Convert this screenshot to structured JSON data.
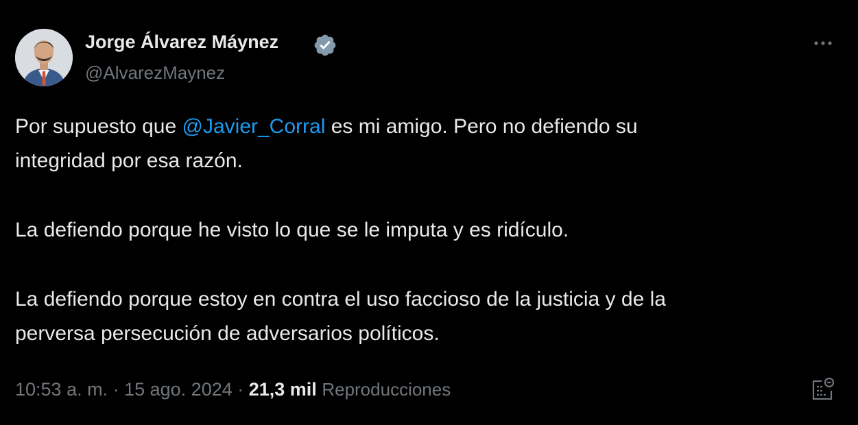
{
  "author": {
    "display_name": "Jorge Álvarez Máynez",
    "handle": "@AlvarezMaynez",
    "verified": true
  },
  "icons": {
    "verified": "verified-badge-icon",
    "more": "more-options-icon",
    "analytics": "post-analytics-icon"
  },
  "tweet": {
    "line1_before": "Por supuesto que ",
    "mention": "@Javier_Corral",
    "line1_after": " es mi amigo. Pero no defiendo su",
    "line2": "integridad por esa razón.",
    "para2": "La defiendo porque he visto lo que se le imputa y es ridículo.",
    "para3_line1": "La defiendo porque estoy en contra el uso faccioso de la justicia y de la",
    "para3_line2": "perversa persecución de adversarios políticos."
  },
  "meta": {
    "time": "10:53 a. m.",
    "separator": " · ",
    "date": "15 ago. 2024",
    "views_count": "21,3 mil",
    "views_label": "Reproducciones"
  },
  "colors": {
    "background": "#000000",
    "text": "#e7e9ea",
    "secondary": "#71767b",
    "link": "#1d9bf0",
    "verified": "#829aab"
  }
}
